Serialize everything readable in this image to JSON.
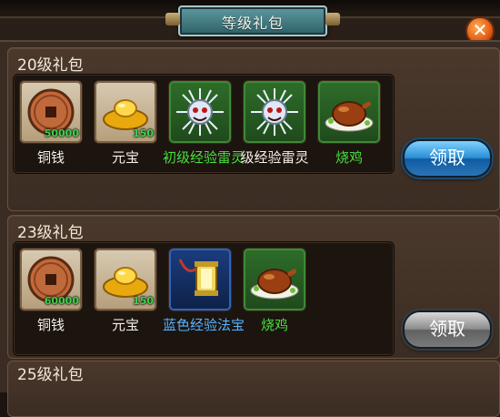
{
  "window": {
    "title": "等级礼包",
    "close_icon": "close-icon"
  },
  "sections": [
    {
      "title": "20级礼包",
      "button_label": "领取",
      "button_state": "active",
      "items": [
        {
          "icon": "copper-coin-icon",
          "name": "铜钱",
          "count": "50000",
          "rarity": "normal"
        },
        {
          "icon": "gold-ingot-icon",
          "name": "元宝",
          "count": "150",
          "rarity": "normal"
        },
        {
          "icon": "thunder-spirit-icon",
          "name": "初级经验雷灵",
          "count": "",
          "rarity": "green"
        },
        {
          "icon": "thunder-spirit-icon",
          "name": "级经验雷灵",
          "count": "",
          "rarity": "green"
        },
        {
          "icon": "roast-chicken-icon",
          "name": "烧鸡",
          "count": "",
          "rarity": "green"
        }
      ]
    },
    {
      "title": "23级礼包",
      "button_label": "领取",
      "button_state": "disabled",
      "items": [
        {
          "icon": "copper-coin-icon",
          "name": "铜钱",
          "count": "60000",
          "rarity": "normal"
        },
        {
          "icon": "gold-ingot-icon",
          "name": "元宝",
          "count": "150",
          "rarity": "normal"
        },
        {
          "icon": "lantern-treasure-icon",
          "name": "蓝色经验法宝",
          "count": "",
          "rarity": "blue"
        },
        {
          "icon": "roast-chicken-icon",
          "name": "烧鸡",
          "count": "",
          "rarity": "green"
        }
      ]
    },
    {
      "title": "25级礼包"
    }
  ]
}
